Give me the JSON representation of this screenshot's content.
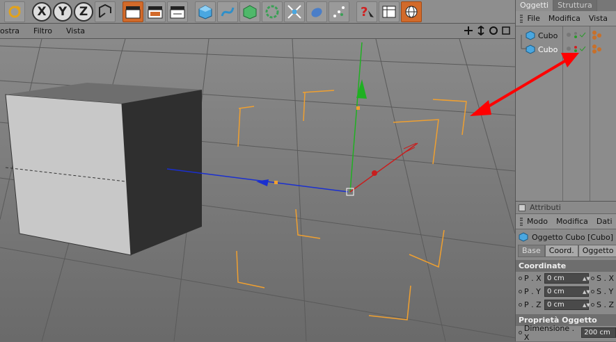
{
  "menubar": {
    "items": [
      "ostra",
      "Filtro",
      "Vista"
    ]
  },
  "toolbar": {
    "axis_labels": [
      "X",
      "Y",
      "Z"
    ]
  },
  "objects_panel": {
    "tabs": [
      "Oggetti",
      "Struttura"
    ],
    "menu": [
      "File",
      "Modifica",
      "Vista"
    ],
    "items": [
      {
        "label": "Cubo"
      },
      {
        "label": "Cubo"
      }
    ]
  },
  "attributes_panel": {
    "header": "Attributi",
    "menu": [
      "Modo",
      "Modifica",
      "Dati"
    ],
    "object_title": "Oggetto Cubo [Cubo]",
    "tabs": [
      "Base",
      "Coord.",
      "Oggetto"
    ],
    "section_coords": "Coordinate",
    "rows": [
      {
        "label": "P . X",
        "value": "0 cm",
        "right": "S . X"
      },
      {
        "label": "P . Y",
        "value": "0 cm",
        "right": "S . Y"
      },
      {
        "label": "P . Z",
        "value": "0 cm",
        "right": "S . Z"
      }
    ],
    "section_props": "Proprietà Oggetto",
    "dim_label": "Dimensione . X",
    "dim_value": "200 cm"
  },
  "colors": {
    "accent_orange": "#f0a030",
    "arrow_red": "#ff0000"
  }
}
